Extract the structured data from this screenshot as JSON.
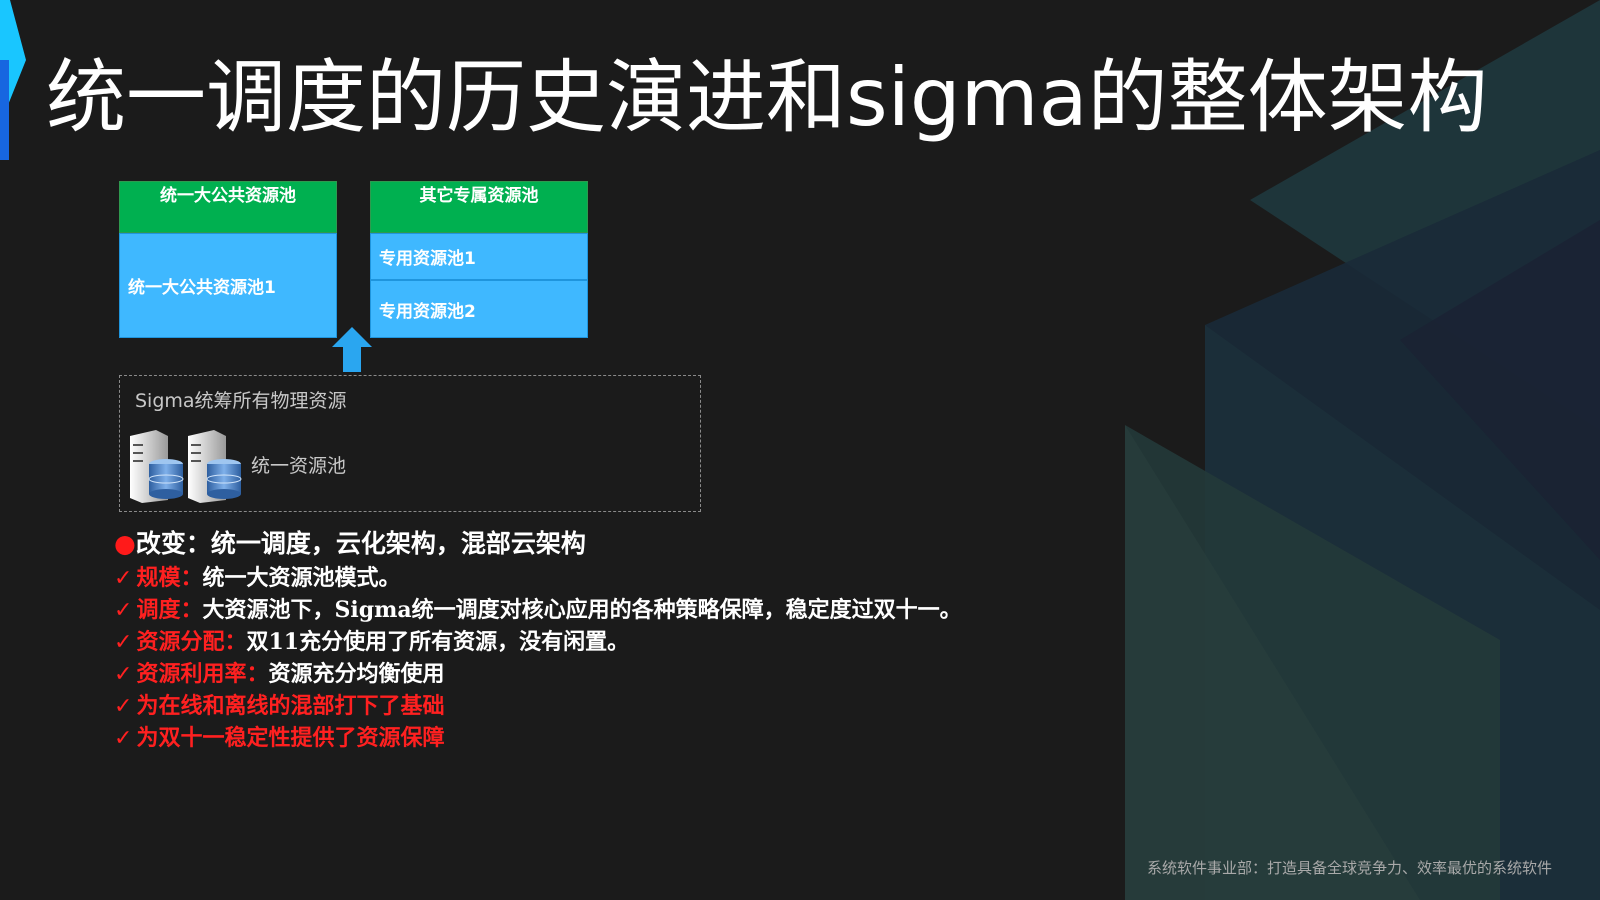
{
  "colors": {
    "background": "#1b1b1b",
    "title": "#ffffff",
    "header_green": "#00b050",
    "pool_blue": "#3fb8ff",
    "accent_blue": "#1a8cff",
    "emphasis_red": "#ff2020"
  },
  "title": "统一调度的历史演进和sigma的整体架构",
  "diagram": {
    "public_pool": {
      "header": "统一大公共资源池",
      "items": [
        "统一大公共资源池1"
      ]
    },
    "dedicated_pool": {
      "header": "其它专属资源池",
      "items": [
        "专用资源池1",
        "专用资源池2"
      ]
    },
    "arrow_icon": "up-arrow-icon",
    "sigma_box": {
      "title": "Sigma统筹所有物理资源",
      "pool_label": "统一资源池",
      "server_icon": "server-database-icon"
    }
  },
  "bullets": {
    "heading": "改变：统一调度，云化架构，混部云架构",
    "items": [
      {
        "check": "✓",
        "label": "规模：",
        "text": "统一大资源池模式。",
        "label_red": true
      },
      {
        "check": "✓",
        "label": "调度：",
        "text": "大资源池下，Sigma统一调度对核心应用的各种策略保障，稳定度过双十一。",
        "label_red": true
      },
      {
        "check": "✓",
        "label": "资源分配：",
        "text": "双11充分使用了所有资源，没有闲置。",
        "label_red": true
      },
      {
        "check": "✓",
        "label": "资源利用率：",
        "text": "资源充分均衡使用",
        "label_red": true
      },
      {
        "check": "✓",
        "label": "为在线和离线的混部打下了基础",
        "text": "",
        "label_red": true
      },
      {
        "check": "✓",
        "label": "为双十一稳定性提供了资源保障",
        "text": "",
        "label_red": true
      }
    ]
  },
  "footer": "系统软件事业部：打造具备全球竞争力、效率最优的系统软件"
}
